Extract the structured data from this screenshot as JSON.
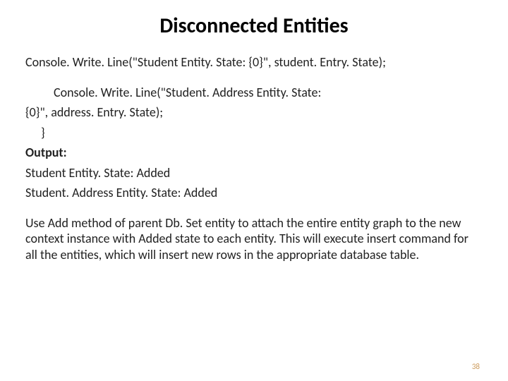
{
  "title": "Disconnected Entities",
  "code_line1": "Console. Write. Line(\"Student Entity. State: {0}\", student. Entry. State);",
  "code_line2a": "Console. Write. Line(\"Student. Address Entity. State:",
  "code_line2b": "{0}\", address. Entry. State);",
  "brace": "}",
  "output_label": "Output:",
  "output1": "Student Entity. State: Added",
  "output2": "Student. Address Entity. State: Added",
  "explain": "Use Add method of parent Db. Set entity to attach the entire entity graph to the new context instance with Added state to each entity. This will execute insert command for all the entities, which will insert new rows in the appropriate database table.",
  "page_number": "38"
}
